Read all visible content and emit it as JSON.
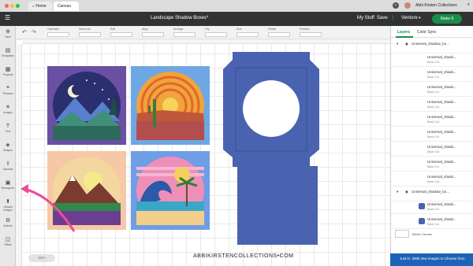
{
  "browser": {
    "tabs": [
      {
        "label": "Home"
      },
      {
        "label": "Canvas"
      }
    ],
    "avatar_name": "Abbi Kirsten Collections"
  },
  "titlebar": {
    "title": "Landscape Shadow Boxes*",
    "my_stuff": "My Stuff",
    "save": "Save",
    "machine": "Venture",
    "make_button": "Make It"
  },
  "options": {
    "items": [
      "Operation",
      "Select All",
      "Edit",
      "Align",
      "Arrange",
      "Flip",
      "Size",
      "Rotate",
      "Position"
    ]
  },
  "tools": [
    {
      "label": "New",
      "icon": "plus-icon"
    },
    {
      "label": "Templates",
      "icon": "shirt-icon"
    },
    {
      "label": "Projects",
      "icon": "grid-icon"
    },
    {
      "label": "Phrases",
      "icon": "quote-icon"
    },
    {
      "label": "Images",
      "icon": "bulb-icon"
    },
    {
      "label": "Text",
      "icon": "text-icon"
    },
    {
      "label": "Shapes",
      "icon": "shapes-icon"
    },
    {
      "label": "Uploads",
      "icon": "upload-icon"
    },
    {
      "label": "Monogram",
      "icon": "monogram-icon"
    },
    {
      "label": "Upload Images",
      "icon": "image-upload-icon"
    },
    {
      "label": "Actions",
      "icon": "actions-icon"
    },
    {
      "label": "Offset",
      "icon": "offset-icon"
    }
  ],
  "layers_panel": {
    "tabs": [
      "Layers",
      "Color Sync"
    ],
    "group_header_1": "Universal_shadow_bo...",
    "layer_name": "Universal_shado...",
    "layer_type": "Basic Cut",
    "group_header_2": "Universal_shadow_bo...",
    "layer_count_first_group": 9,
    "blank_canvas": "Blank Canvas",
    "promo": "Just in: 300k new images to Choose from"
  },
  "canvas": {
    "zoom": "60%",
    "watermark": "ABBIKIRSTENCOLLECTIONS•COM",
    "colors": {
      "box_blue": "#4a63b0",
      "pink_frame": "#f6d3dc",
      "make_green": "#1a8d4b"
    }
  }
}
